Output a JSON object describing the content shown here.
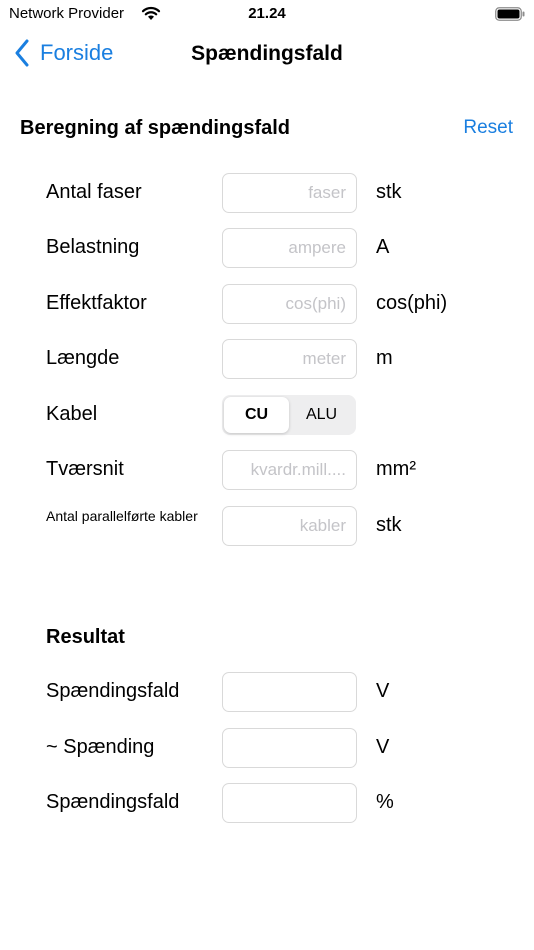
{
  "status_bar": {
    "carrier": "Network Provider",
    "time": "21.24"
  },
  "nav": {
    "back_label": "Forside",
    "title": "Spændingsfald"
  },
  "calculation": {
    "title": "Beregning af spændingsfald",
    "reset_label": "Reset",
    "fields": [
      {
        "label": "Antal faser",
        "placeholder": "faser",
        "value": "",
        "unit": "stk"
      },
      {
        "label": "Belastning",
        "placeholder": "ampere",
        "value": "",
        "unit": "A"
      },
      {
        "label": "Effektfaktor",
        "placeholder": "cos(phi)",
        "value": "",
        "unit": "cos(phi)"
      },
      {
        "label": "Længde",
        "placeholder": "meter",
        "value": "",
        "unit": "m"
      }
    ],
    "cable": {
      "label": "Kabel",
      "options": [
        "CU",
        "ALU"
      ],
      "selected": "CU"
    },
    "cross_section": {
      "label": "Tværsnit",
      "placeholder": "kvardr.mill....",
      "value": "",
      "unit": "mm²"
    },
    "parallel": {
      "label": "Antal parallelførte kabler",
      "placeholder": "kabler",
      "value": "",
      "unit": "stk"
    }
  },
  "result": {
    "title": "Resultat",
    "fields": [
      {
        "label": "Spændingsfald",
        "value": "",
        "unit": "V"
      },
      {
        "label": "~ Spænding",
        "value": "",
        "unit": "V"
      },
      {
        "label": "Spændingsfald",
        "value": "",
        "unit": "%"
      }
    ]
  },
  "colors": {
    "accent": "#1a7fe0",
    "field_border": "#d9d9d9",
    "placeholder": "#c4c4c8",
    "segment_background": "#eeeeef"
  }
}
